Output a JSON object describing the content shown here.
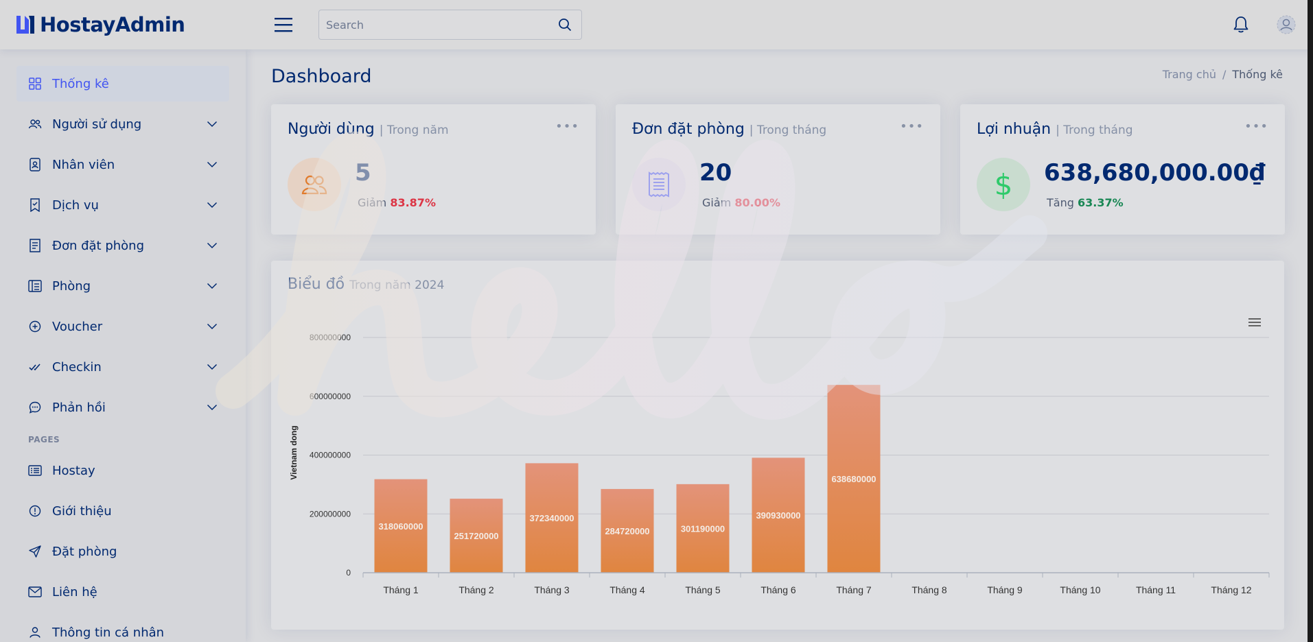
{
  "app": {
    "brand": "HostayAdmin"
  },
  "header": {
    "search_placeholder": "Search"
  },
  "sidebar": {
    "items": [
      {
        "label": "Thống kê",
        "icon": "grid-icon",
        "active": true,
        "expandable": false
      },
      {
        "label": "Người sử dụng",
        "icon": "people-icon",
        "active": false,
        "expandable": true
      },
      {
        "label": "Nhân viên",
        "icon": "badge-icon",
        "active": false,
        "expandable": true
      },
      {
        "label": "Dịch vụ",
        "icon": "bookmark-icon",
        "active": false,
        "expandable": true
      },
      {
        "label": "Đơn đặt phòng",
        "icon": "receipt-icon",
        "active": false,
        "expandable": true
      },
      {
        "label": "Phòng",
        "icon": "layout-icon",
        "active": false,
        "expandable": true
      },
      {
        "label": "Voucher",
        "icon": "plus-circle-icon",
        "active": false,
        "expandable": true
      },
      {
        "label": "Checkin",
        "icon": "check-icon",
        "active": false,
        "expandable": true
      },
      {
        "label": "Phản hồi",
        "icon": "chat-icon",
        "active": false,
        "expandable": true
      }
    ],
    "pages_heading": "Pages",
    "pages": [
      {
        "label": "Hostay",
        "icon": "card-list-icon"
      },
      {
        "label": "Giới thiệu",
        "icon": "info-circle-icon"
      },
      {
        "label": "Đặt phòng",
        "icon": "send-icon"
      },
      {
        "label": "Liên hệ",
        "icon": "envelope-icon"
      },
      {
        "label": "Thông tin cá nhân",
        "icon": "person-icon"
      }
    ]
  },
  "main": {
    "title": "Dashboard",
    "breadcrumb": {
      "home": "Trang chủ",
      "current": "Thống kê",
      "separator": "/"
    },
    "stats": [
      {
        "title": "Người dùng",
        "period": "| Trong năm",
        "value": "5",
        "change_label": "Giảm",
        "change_pct": "83.87%",
        "trend": "down",
        "icon": "people-icon",
        "icon_bg": "#e6d2c4",
        "icon_color": "#e07a2b"
      },
      {
        "title": "Đơn đặt phòng",
        "period": "| Trong tháng",
        "value": "20",
        "change_label": "Giảm",
        "change_pct": "80.00%",
        "trend": "down",
        "icon": "receipt-icon",
        "icon_bg": "#d5d5e2",
        "icon_color": "#4154f1"
      },
      {
        "title": "Lợi nhuận",
        "period": "| Trong tháng",
        "value": "638,680,000.00₫",
        "change_label": "Tăng",
        "change_pct": "63.37%",
        "trend": "up",
        "icon": "dollar-icon",
        "icon_bg": "#c9dccf",
        "icon_color": "#2eca6a"
      }
    ],
    "chart_card": {
      "title": "Biểu đồ",
      "period": "Trong năm 2024"
    }
  },
  "colors": {
    "brand": "#012970",
    "accent": "#4154f1",
    "down": "#dc3545",
    "up": "#198754",
    "bar": "#e68a4e"
  },
  "chart_data": {
    "type": "bar",
    "categories": [
      "Tháng 1",
      "Tháng 2",
      "Tháng 3",
      "Tháng 4",
      "Tháng 5",
      "Tháng 6",
      "Tháng 7",
      "Tháng 8",
      "Tháng 9",
      "Tháng 10",
      "Tháng 11",
      "Tháng 12"
    ],
    "values": [
      318060000,
      251720000,
      372340000,
      284720000,
      301190000,
      390930000,
      638680000,
      null,
      null,
      null,
      null,
      null
    ],
    "data_labels": [
      "318060000",
      "251720000",
      "372340000",
      "284720000",
      "301190000",
      "390930000",
      "638680000"
    ],
    "ylabel": "Vietnam dong",
    "ylim": [
      0,
      800000000
    ],
    "yticks": [
      "0",
      "200000000",
      "400000000",
      "600000000",
      "800000000"
    ],
    "grid": true
  }
}
